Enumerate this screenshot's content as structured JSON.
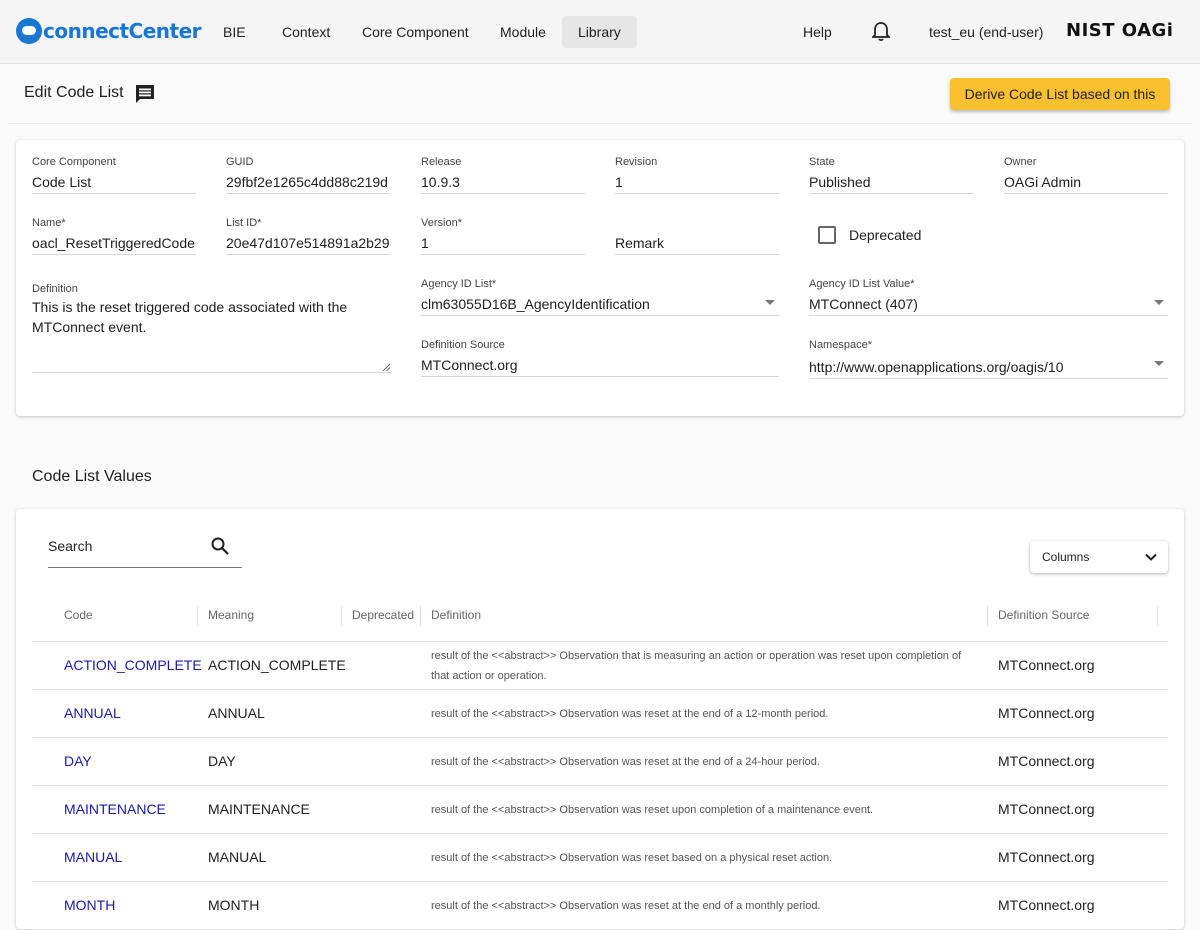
{
  "app": {
    "logo_text": "connectCenter",
    "nav": [
      "BIE",
      "Context",
      "Core Component",
      "Module",
      "Library"
    ],
    "active_nav": "Library",
    "help": "Help",
    "user": "test_eu (end-user)",
    "brand_right": "NIST OAGi"
  },
  "header": {
    "title": "Edit Code List",
    "derive_button": "Derive Code List based on this"
  },
  "form": {
    "core_component": {
      "label": "Core Component",
      "value": "Code List"
    },
    "guid": {
      "label": "GUID",
      "value": "29fbf2e1265c4dd88c219d"
    },
    "release": {
      "label": "Release",
      "value": "10.9.3"
    },
    "revision": {
      "label": "Revision",
      "value": "1"
    },
    "state": {
      "label": "State",
      "value": "Published"
    },
    "owner": {
      "label": "Owner",
      "value": "OAGi Admin"
    },
    "name": {
      "label": "Name*",
      "value": "oacl_ResetTriggeredCode"
    },
    "list_id": {
      "label": "List ID*",
      "value": "20e47d107e514891a2b29"
    },
    "version": {
      "label": "Version*",
      "value": "1"
    },
    "remark": {
      "placeholder": "Remark"
    },
    "deprecated": {
      "label": "Deprecated",
      "checked": false
    },
    "definition": {
      "label": "Definition",
      "value": "This is the reset triggered code associated with the MTConnect event."
    },
    "agency_id_list": {
      "label": "Agency ID List*",
      "value": "clm63055D16B_AgencyIdentification"
    },
    "agency_id_list_value": {
      "label": "Agency ID List Value*",
      "value": "MTConnect (407)"
    },
    "definition_source": {
      "label": "Definition Source",
      "value": "MTConnect.org"
    },
    "namespace": {
      "label": "Namespace*",
      "value": "http://www.openapplications.org/oagis/10"
    }
  },
  "values_section": {
    "title": "Code List Values",
    "search_placeholder": "Search",
    "columns_label": "Columns",
    "headers": [
      "Code",
      "Meaning",
      "Deprecated",
      "Definition",
      "Definition Source"
    ],
    "rows": [
      {
        "code": "ACTION_COMPLETE",
        "meaning": "ACTION_COMPLETE",
        "definition": "result of the <<abstract>> Observation that is measuring an action or operation was reset upon completion of that action or operation.",
        "source": "MTConnect.org"
      },
      {
        "code": "ANNUAL",
        "meaning": "ANNUAL",
        "definition": "result of the <<abstract>> Observation was reset at the end of a 12-month period.",
        "source": "MTConnect.org"
      },
      {
        "code": "DAY",
        "meaning": "DAY",
        "definition": "result of the <<abstract>> Observation was reset at the end of a 24-hour period.",
        "source": "MTConnect.org"
      },
      {
        "code": "MAINTENANCE",
        "meaning": "MAINTENANCE",
        "definition": "result of the <<abstract>> Observation was reset upon completion of a maintenance event.",
        "source": "MTConnect.org"
      },
      {
        "code": "MANUAL",
        "meaning": "MANUAL",
        "definition": "result of the <<abstract>> Observation was reset based on a physical reset action.",
        "source": "MTConnect.org"
      },
      {
        "code": "MONTH",
        "meaning": "MONTH",
        "definition": "result of the <<abstract>> Observation was reset at the end of a monthly period.",
        "source": "MTConnect.org"
      }
    ]
  },
  "colors": {
    "accent": "#fbc02d",
    "link": "#1a1aa6",
    "brand": "#1976d2"
  }
}
